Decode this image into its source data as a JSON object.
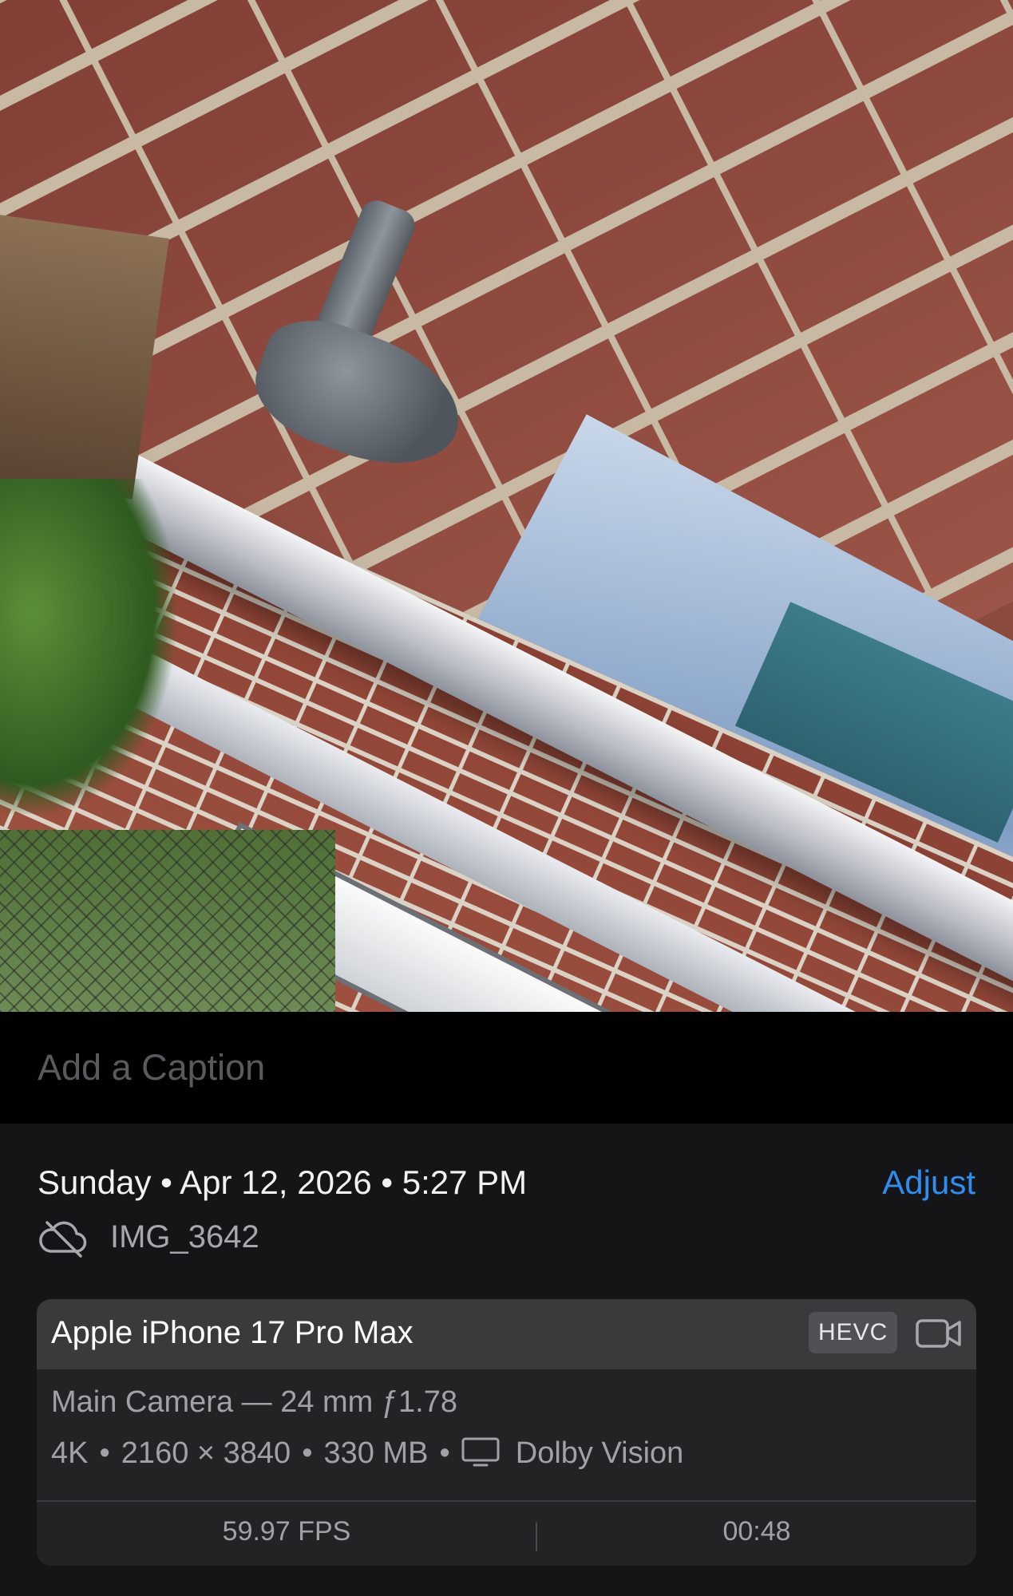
{
  "caption": {
    "placeholder": "Add a Caption"
  },
  "metadata": {
    "date_line": "Sunday • Apr 12, 2026 • 5:27 PM",
    "adjust_label": "Adjust",
    "filename": "IMG_3642",
    "sync_icon": "cloud-slash-icon"
  },
  "device_card": {
    "device": "Apple iPhone 17 Pro Max",
    "format_badge": "HEVC",
    "media_icon": "video-camera-icon",
    "camera": "Main Camera — 24 mm ƒ1.78",
    "resolution": "4K",
    "dimensions": "2160 × 3840",
    "size": "330 MB",
    "hdr_icon": "display-icon",
    "hdr": "Dolby Vision",
    "fps": "59.97 FPS",
    "duration": "00:48"
  },
  "colors": {
    "accent": "#2E8EF0",
    "panel": "#151517",
    "card": "#232326",
    "card_header": "#3A3A3D"
  }
}
